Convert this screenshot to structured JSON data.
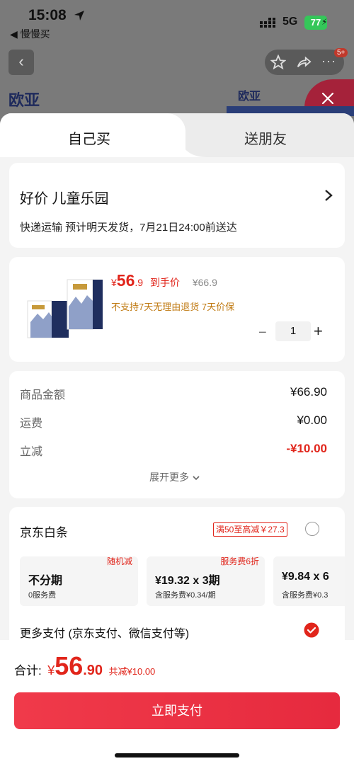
{
  "status_bar": {
    "time": "15:08",
    "back_app": "◀ 慢慢买",
    "network": "5G",
    "battery": "77"
  },
  "background": {
    "badge": "5+",
    "brand": "欧亚"
  },
  "tabs": [
    {
      "label": "自己买"
    },
    {
      "label": "送朋友"
    }
  ],
  "address": {
    "title": "好价 儿童乐园",
    "shipping": "快递运输 预计明天发货，7月21日24:00前送达"
  },
  "product": {
    "price_yen": "¥",
    "price_int": "56",
    "price_dec": ".9",
    "price_tag": "到手价",
    "original_price": "¥66.9",
    "note": "不支持7天无理由退货  7天价保",
    "quantity": "1"
  },
  "summary": {
    "rows": [
      {
        "label": "商品金额",
        "value": "¥66.90"
      },
      {
        "label": "运费",
        "value": "¥0.00"
      },
      {
        "label": "立减",
        "value": "-¥10.00"
      }
    ],
    "expand": "展开更多"
  },
  "payment": {
    "baitiao_title": "京东白条",
    "baitiao_promo": "满50至高减￥27.3",
    "installments": [
      {
        "tag": "随机减",
        "main": "不分期",
        "sub": "0服务费"
      },
      {
        "tag": "服务费6折",
        "main": "¥19.32 x 3期",
        "sub": "含服务费¥0.34/期"
      },
      {
        "tag": "",
        "main": "¥9.84 x 6",
        "sub": "含服务费¥0.3"
      }
    ],
    "more_pay": "更多支付 (京东支付、微信支付等)"
  },
  "footer": {
    "total_label": "合计:",
    "total_yen": "¥",
    "total_int": "56",
    "total_dec": ".90",
    "discount": "共减¥10.00",
    "pay_button": "立即支付"
  },
  "colors": {
    "accent": "#e1251b",
    "note": "#c07a12",
    "pay_button": "#ee3446"
  }
}
